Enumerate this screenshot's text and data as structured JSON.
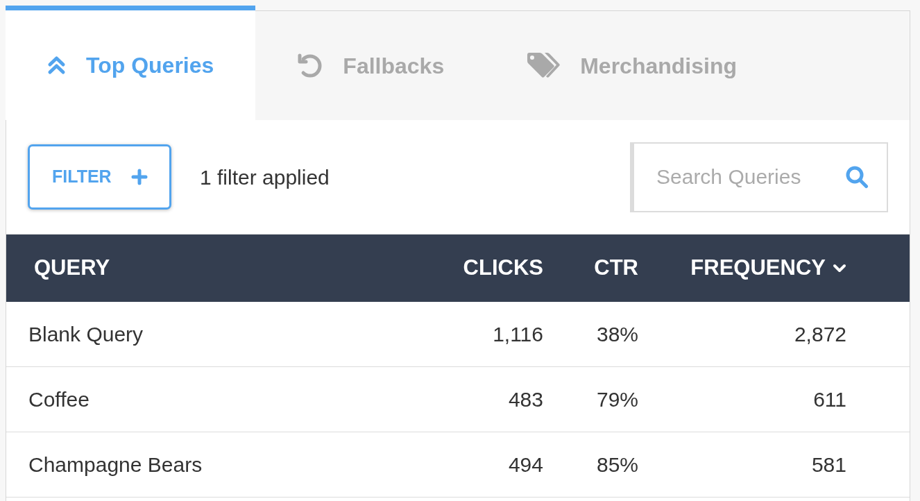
{
  "tabs": [
    {
      "label": "Top Queries",
      "selected": true
    },
    {
      "label": "Fallbacks",
      "selected": false
    },
    {
      "label": "Merchandising",
      "selected": false
    }
  ],
  "toolbar": {
    "filter_button": {
      "label": "FILTER"
    },
    "filter_status": "1 filter applied",
    "search": {
      "placeholder": "Search Queries"
    }
  },
  "table": {
    "columns": [
      {
        "label": "QUERY",
        "sorted": false
      },
      {
        "label": "CLICKS",
        "sorted": false
      },
      {
        "label": "CTR",
        "sorted": false
      },
      {
        "label": "FREQUENCY",
        "sorted": true
      }
    ],
    "rows": [
      {
        "cells": [
          "Blank Query",
          "1,116",
          "38%",
          "2,872"
        ]
      },
      {
        "cells": [
          "Coffee",
          "483",
          "79%",
          "611"
        ]
      },
      {
        "cells": [
          "Champagne Bears",
          "494",
          "85%",
          "581"
        ]
      }
    ]
  }
}
